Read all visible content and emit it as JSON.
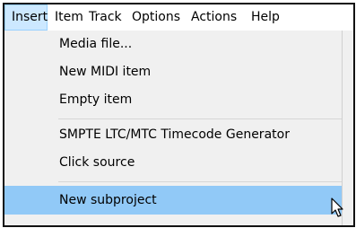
{
  "menubar": {
    "items": [
      {
        "label": "Insert",
        "active": true
      },
      {
        "label": "Item"
      },
      {
        "label": "Track"
      },
      {
        "label": "Options"
      },
      {
        "label": "Actions"
      },
      {
        "label": "Help"
      }
    ]
  },
  "dropdown": {
    "items": [
      {
        "label": "Media file..."
      },
      {
        "label": "New MIDI item"
      },
      {
        "label": "Empty item"
      },
      {
        "label": "SMPTE LTC/MTC Timecode Generator"
      },
      {
        "label": "Click source"
      },
      {
        "label": "New subproject",
        "highlighted": true
      }
    ]
  },
  "colors": {
    "active_menu_bg": "#cce8ff",
    "active_menu_border": "#99d1ff",
    "highlight_bg": "#91c9f7",
    "menu_bg": "#f0f0f0"
  },
  "cursor": {
    "icon": "arrow-pointer-icon"
  }
}
